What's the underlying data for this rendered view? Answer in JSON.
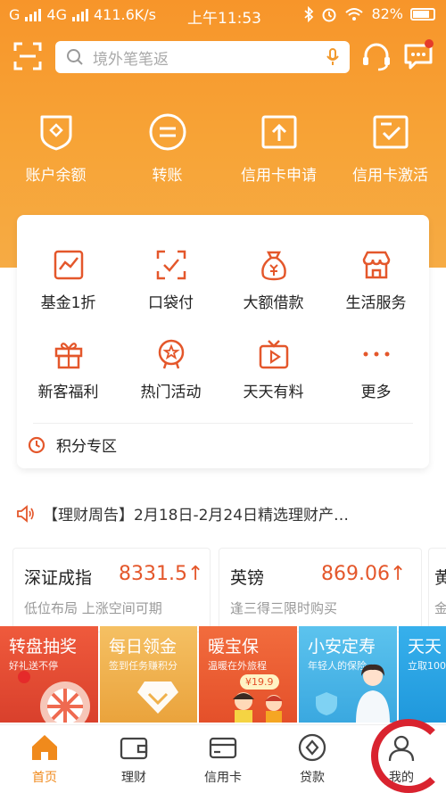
{
  "status_bar": {
    "carrier1": "G",
    "carrier2": "4G",
    "speed": "411.6K/s",
    "time": "上午11:53",
    "battery": "82%"
  },
  "search": {
    "placeholder": "境外笔笔返"
  },
  "quick_actions": [
    {
      "label": "账户余额",
      "icon": "wallet-shield-icon"
    },
    {
      "label": "转账",
      "icon": "transfer-icon"
    },
    {
      "label": "信用卡申请",
      "icon": "card-apply-icon"
    },
    {
      "label": "信用卡激活",
      "icon": "card-activate-icon"
    }
  ],
  "menu": [
    {
      "label": "基金1折",
      "icon": "chart-icon"
    },
    {
      "label": "口袋付",
      "icon": "scan-pay-icon"
    },
    {
      "label": "大额借款",
      "icon": "money-bag-icon"
    },
    {
      "label": "生活服务",
      "icon": "shop-icon"
    },
    {
      "label": "新客福利",
      "icon": "gift-icon"
    },
    {
      "label": "热门活动",
      "icon": "star-badge-icon"
    },
    {
      "label": "天天有料",
      "icon": "tv-play-icon"
    },
    {
      "label": "更多",
      "icon": "more-dots-icon"
    }
  ],
  "points": {
    "label": "积分专区"
  },
  "notice": {
    "text": "【理财周告】2月18日-2月24日精选理财产…"
  },
  "markets": [
    {
      "name": "深证成指",
      "value": "8331.5↑",
      "sub": "低位布局 上涨空间可期"
    },
    {
      "name": "英镑",
      "value": "869.06↑",
      "sub": "逢三得三限时购买"
    },
    {
      "name": "黄",
      "value": "",
      "sub": "金"
    }
  ],
  "banners": [
    {
      "title": "转盘抽奖",
      "sub": "好礼送不停",
      "color": "#e24a32"
    },
    {
      "title": "每日领金",
      "sub": "签到任务赚积分",
      "color": "#f0b14a"
    },
    {
      "title": "暖宝保",
      "sub": "温暖在外旅程",
      "badge": "¥19.9",
      "color": "#f06a3a"
    },
    {
      "title": "小安定寿",
      "sub": "年轻人的保险",
      "color": "#47b7e8"
    },
    {
      "title": "天天",
      "sub": "立取100",
      "color": "#2aa7e8"
    }
  ],
  "nav": [
    {
      "label": "首页",
      "icon": "home-icon",
      "active": true
    },
    {
      "label": "理财",
      "icon": "wallet-icon"
    },
    {
      "label": "信用卡",
      "icon": "credit-card-icon"
    },
    {
      "label": "贷款",
      "icon": "loan-coin-icon"
    },
    {
      "label": "我的",
      "icon": "user-icon"
    }
  ],
  "colors": {
    "brand": "#f7952a",
    "accent_red": "#e4572b",
    "annotation_ring": "#d9232f"
  }
}
